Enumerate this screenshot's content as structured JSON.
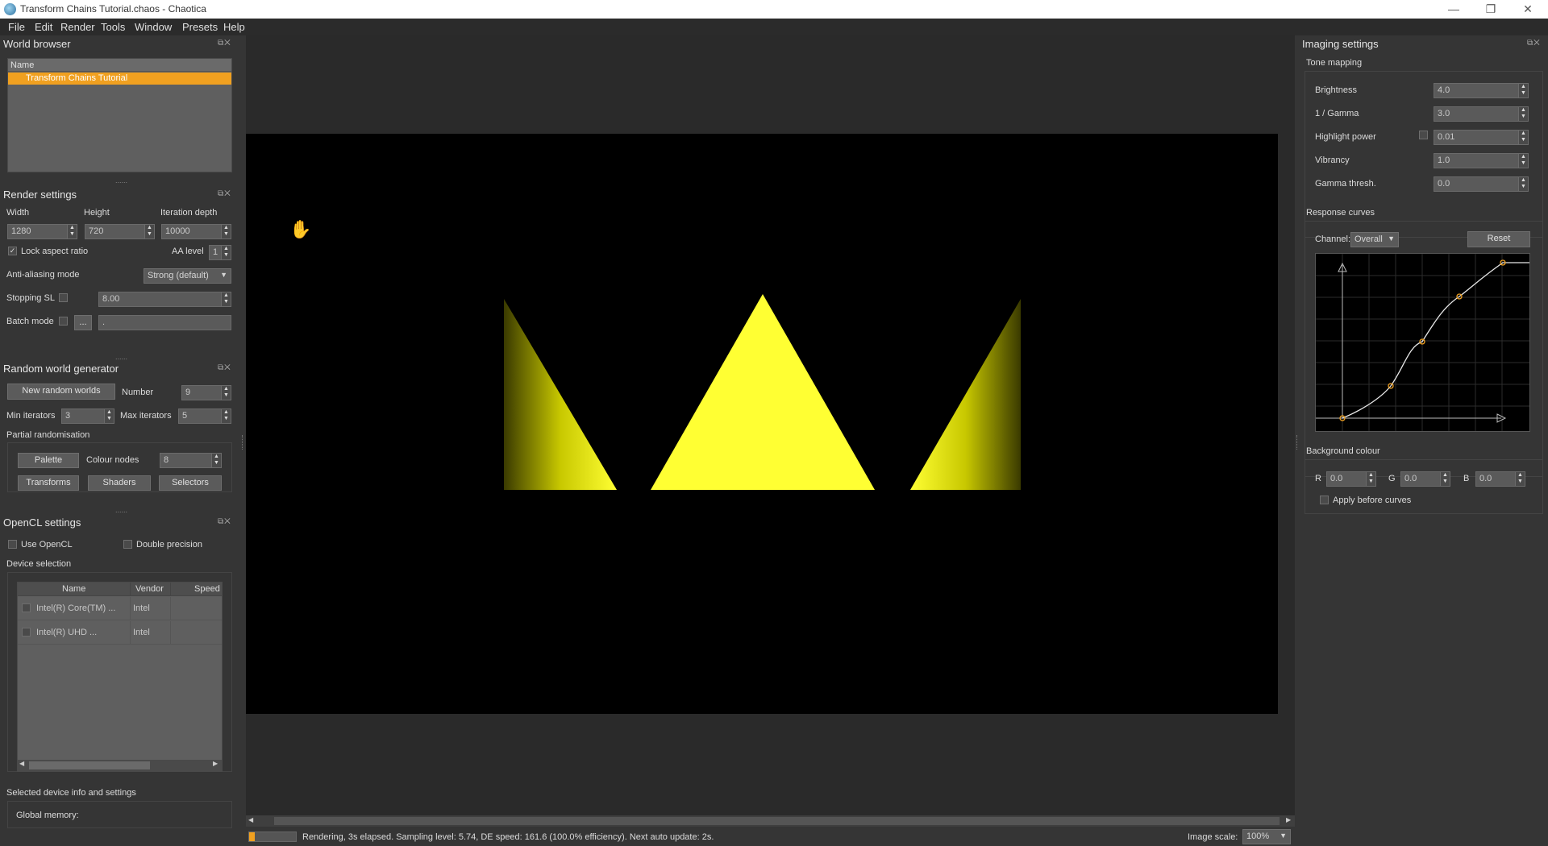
{
  "window": {
    "title": "Transform Chains Tutorial.chaos - Chaotica",
    "minimize": "—",
    "maximize": "❐",
    "close": "✕"
  },
  "menu": [
    "File",
    "Edit",
    "Render",
    "Tools",
    "Window",
    "Presets",
    "Help"
  ],
  "world_browser": {
    "title": "World browser",
    "column_name": "Name",
    "items": [
      "Transform Chains Tutorial"
    ]
  },
  "render_settings": {
    "title": "Render settings",
    "width_label": "Width",
    "height_label": "Height",
    "iteration_label": "Iteration depth",
    "width": "1280",
    "height": "720",
    "iteration_depth": "10000",
    "lock_aspect_label": "Lock aspect ratio",
    "aa_level_label": "AA level",
    "aa_level": "1",
    "aa_mode_label": "Anti-aliasing mode",
    "aa_mode": "Strong (default)",
    "stopping_sl_label": "Stopping SL",
    "stopping_sl": "8.00",
    "batch_mode_label": "Batch mode",
    "batch_button": "...",
    "batch_value": "."
  },
  "random_world": {
    "title": "Random world generator",
    "new_button": "New random worlds",
    "number_label": "Number",
    "number": "9",
    "min_iter_label": "Min iterators",
    "min_iter": "3",
    "max_iter_label": "Max iterators",
    "max_iter": "5",
    "partial_label": "Partial randomisation",
    "palette_button": "Palette",
    "colour_nodes_label": "Colour nodes",
    "colour_nodes": "8",
    "transforms_button": "Transforms",
    "shaders_button": "Shaders",
    "selectors_button": "Selectors"
  },
  "opencl": {
    "title": "OpenCL settings",
    "use_opencl_label": "Use OpenCL",
    "double_precision_label": "Double precision",
    "device_selection_label": "Device selection",
    "columns": [
      "Name",
      "Vendor",
      "Speed"
    ],
    "devices": [
      {
        "name": "Intel(R) Core(TM) ...",
        "vendor": "Intel",
        "speed": ""
      },
      {
        "name": "Intel(R) UHD ...",
        "vendor": "Intel",
        "speed": ""
      }
    ],
    "selected_device_label": "Selected device info and settings",
    "global_memory_label": "Global memory:"
  },
  "imaging": {
    "title": "Imaging settings",
    "tone_mapping_label": "Tone mapping",
    "brightness_label": "Brightness",
    "brightness": "4.0",
    "gamma_label": "1 / Gamma",
    "gamma": "3.0",
    "highlight_label": "Highlight power",
    "highlight": "0.01",
    "vibrancy_label": "Vibrancy",
    "vibrancy": "1.0",
    "gamma_thresh_label": "Gamma thresh.",
    "gamma_thresh": "0.0",
    "response_curves_label": "Response curves",
    "channel_label": "Channel:",
    "channel": "Overall",
    "reset_button": "Reset",
    "background_label": "Background colour",
    "r_label": "R",
    "r": "0.0",
    "g_label": "G",
    "g": "0.0",
    "b_label": "B",
    "b": "0.0",
    "apply_before_label": "Apply before curves"
  },
  "status": {
    "text": "Rendering, 3s elapsed. Sampling level: 5.74, DE speed: 161.6 (100.0% efficiency). Next auto update: 2s.",
    "progress": 0.12,
    "image_scale_label": "Image scale:",
    "image_scale": "100%"
  },
  "colors": {
    "accent": "#f0a020",
    "triangle": "#ffff33",
    "background": "#353535"
  }
}
